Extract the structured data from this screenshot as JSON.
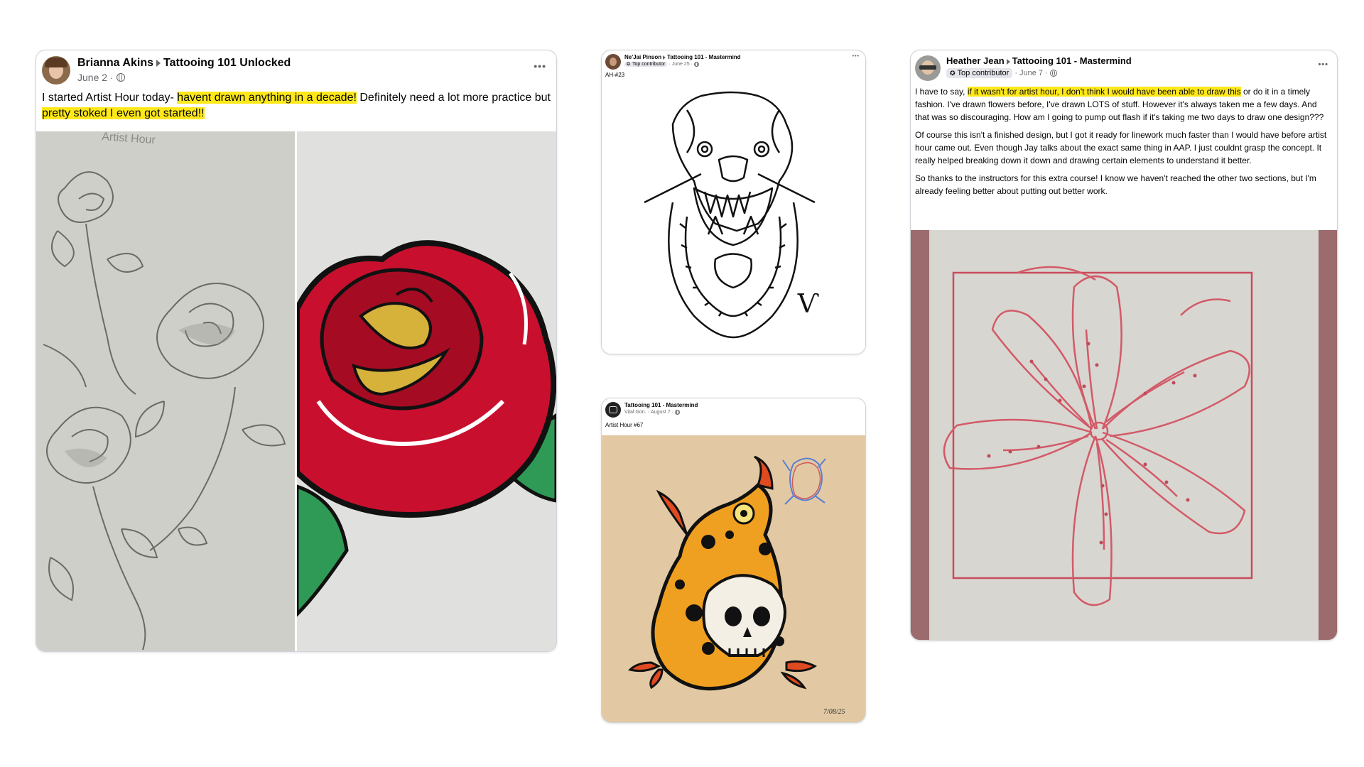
{
  "posts": [
    {
      "author": "Brianna Akins",
      "group": "Tattooing 101 Unlocked",
      "date": "June 2",
      "text_parts": [
        {
          "t": "I started Artist Hour today- ",
          "h": false
        },
        {
          "t": "havent drawn anything in a decade!",
          "h": true
        },
        {
          "t": " Definitely need a lot more practice but ",
          "h": false
        },
        {
          "t": "pretty stoked I even got started!!",
          "h": true
        }
      ],
      "photo_caption": "Artist Hour",
      "more_label": "•••"
    },
    {
      "author": "Ne'Jai Pinson",
      "group": "Tattooing 101 - Mastermind",
      "badge": "Top contributor",
      "date": "June 25",
      "text": "AH-#23",
      "signature": "Ѵ",
      "more_label": "•••"
    },
    {
      "author": "Tattooing 101 - Mastermind",
      "byline": "Vital Gon.",
      "date": "August 7",
      "text": "Artist Hour #67",
      "photo_date": "7/08/25",
      "more_label": ""
    },
    {
      "author": "Heather Jean",
      "group": "Tattooing 101 - Mastermind",
      "badge": "Top contributor",
      "date": "June 7",
      "para1_parts": [
        {
          "t": "I have to say, ",
          "h": false
        },
        {
          "t": "if it wasn't for artist hour, I don't think I would have been able to draw this",
          "h": true
        },
        {
          "t": " or do it in a timely fashion. I've drawn flowers before, I've drawn LOTS of stuff. However it's always taken me a few days. And that was so discouraging. How am I going to pump out flash if it's taking me two days to draw one design???",
          "h": false
        }
      ],
      "para2": "Of course this isn't a finished design, but I got it ready for linework much faster than I would have before artist hour came out. Even though Jay talks about the exact same thing in AAP. I just couldnt grasp the concept. It really helped breaking down it down and drawing certain elements to understand it better.",
      "para3": "So thanks to the instructors for this extra course! I know we haven't reached the other two sections, but I'm already feeling better about putting out better work.",
      "more_label": "•••"
    }
  ],
  "colors": {
    "highlight": "#ffe81a",
    "rose_red": "#c8102e",
    "frog_orange": "#f0a020",
    "lily_pencil": "#d25a68",
    "tan_background": "#e2c9a4"
  },
  "icons": [
    "globe-icon",
    "more-icon",
    "badge-icon",
    "avatar"
  ]
}
